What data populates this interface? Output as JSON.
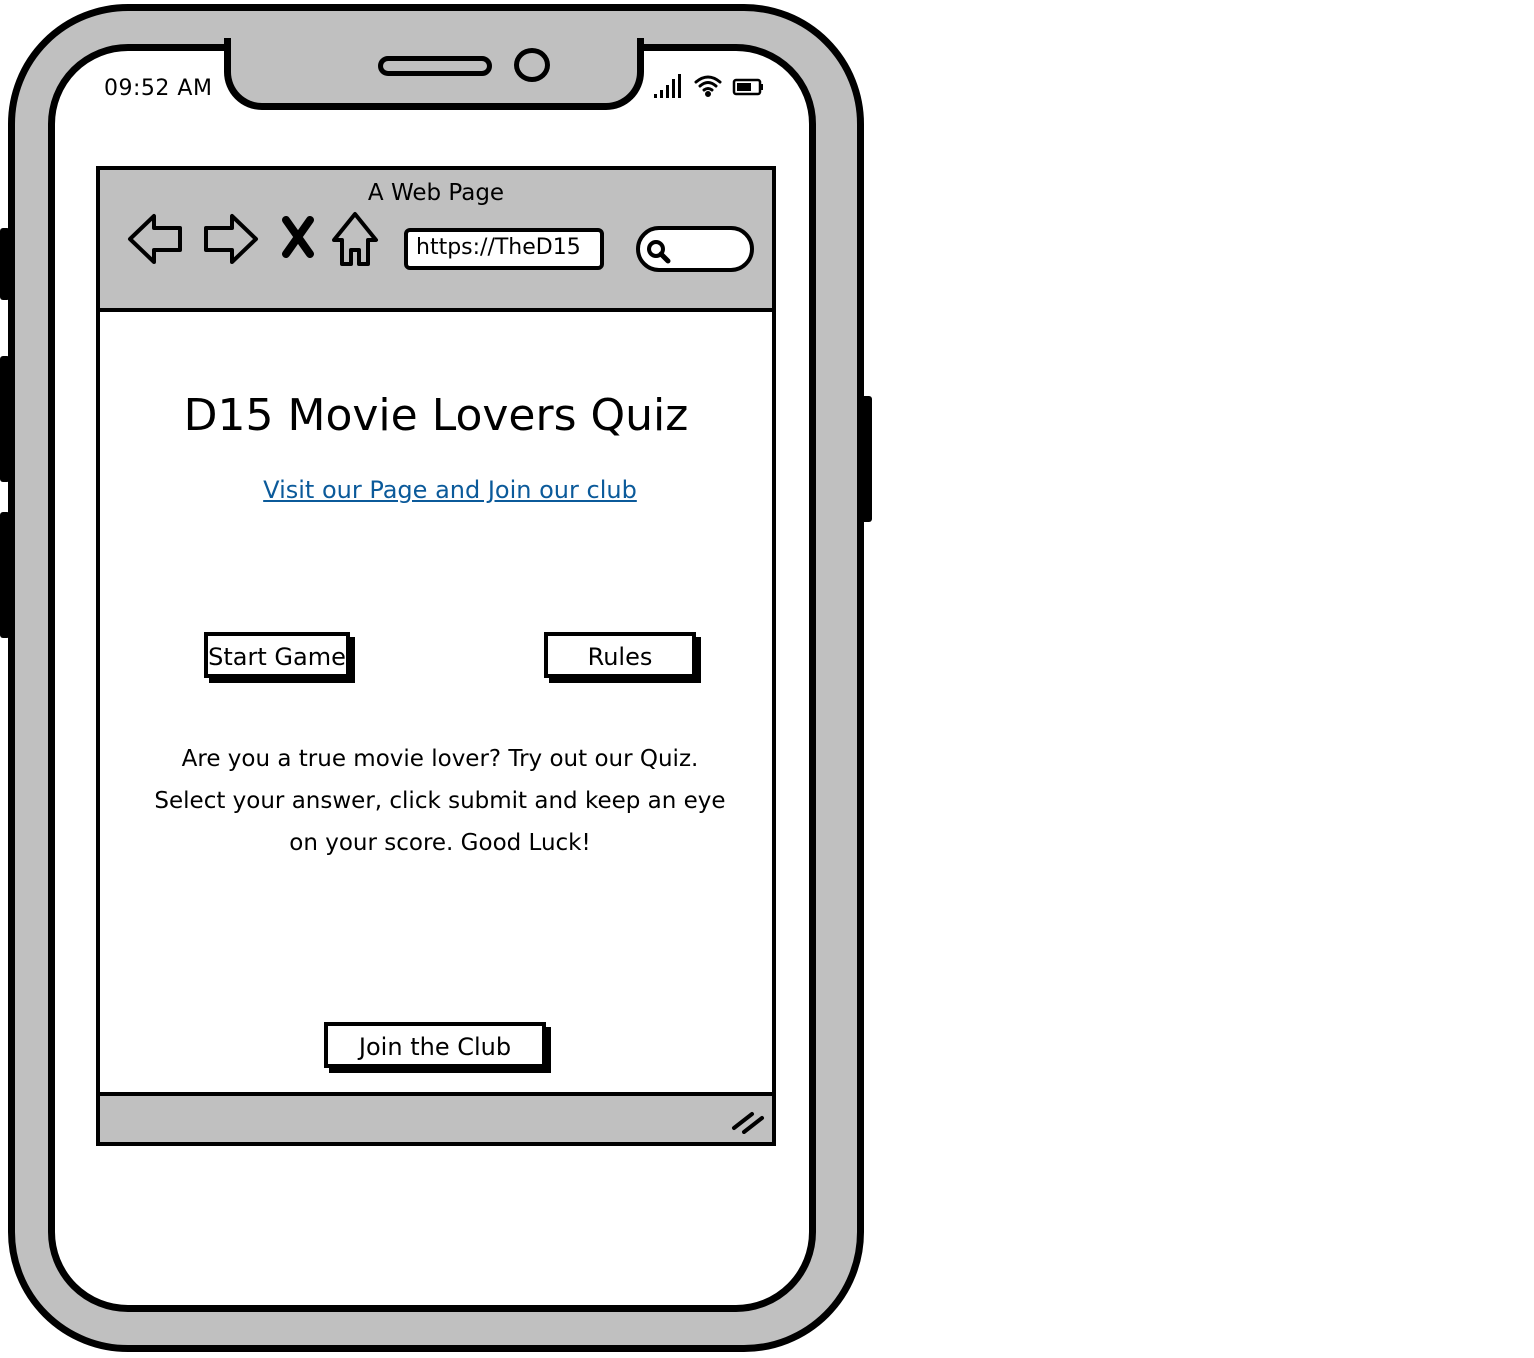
{
  "status_bar": {
    "time": "09:52 AM"
  },
  "browser": {
    "title": "A Web Page",
    "url": "https://TheD15",
    "search_placeholder": ""
  },
  "page": {
    "title": "D15 Movie Lovers Quiz",
    "link_text": "Visit our Page and Join our club",
    "start_button": "Start Game",
    "rules_button": "Rules",
    "intro_line_1": "Are you a true movie lover? Try out our Quiz.",
    "intro_line_2": "Select your answer, click submit and keep an eye",
    "intro_line_3": "on your score. Good Luck!",
    "join_button": "Join the Club"
  },
  "colors": {
    "frame_gray": "#c0c0c0",
    "link_blue": "#0b5a9a"
  },
  "icons": [
    "back-arrow-icon",
    "forward-arrow-icon",
    "stop-icon",
    "home-icon",
    "search-icon",
    "signal-icon",
    "wifi-icon",
    "battery-icon",
    "resize-grip-icon"
  ]
}
